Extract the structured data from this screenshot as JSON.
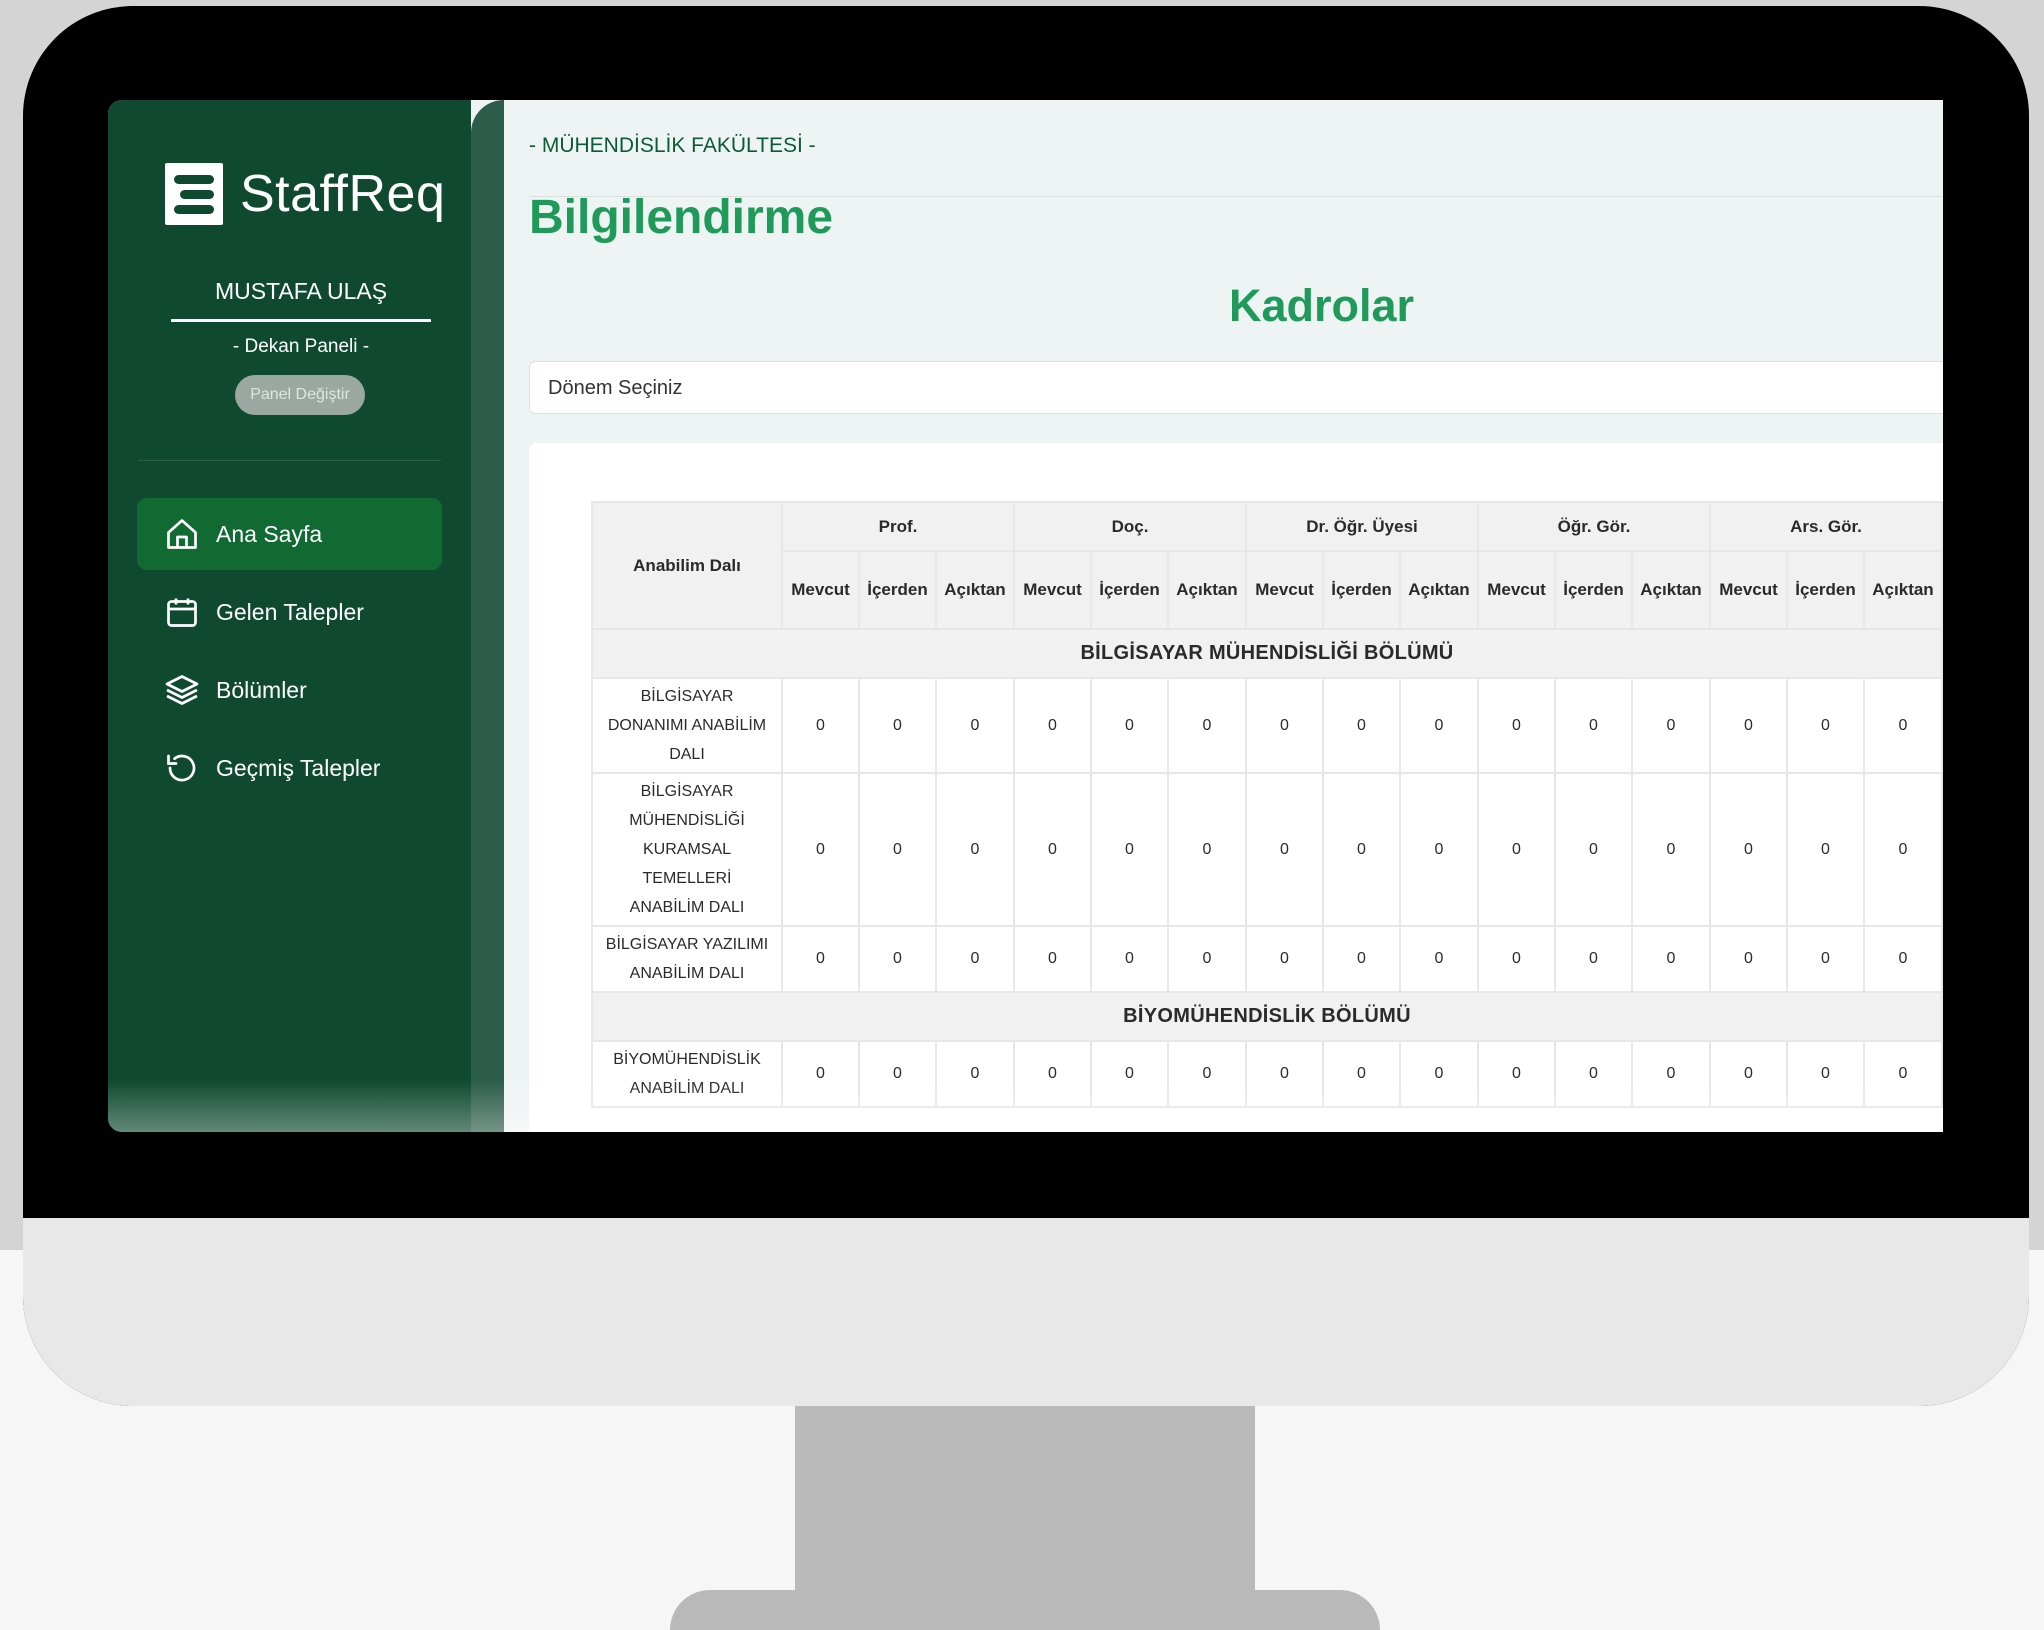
{
  "app": {
    "name": "StaffReq"
  },
  "user": {
    "name": "MUSTAFA ULAŞ",
    "panel": "- Dekan Paneli -",
    "switch_label": "Panel Değiştir"
  },
  "nav": [
    {
      "label": "Ana Sayfa",
      "icon": "home-icon",
      "active": true
    },
    {
      "label": "Gelen Talepler",
      "icon": "calendar-icon",
      "active": false
    },
    {
      "label": "Bölümler",
      "icon": "layers-icon",
      "active": false
    },
    {
      "label": "Geçmiş Talepler",
      "icon": "history-icon",
      "active": false
    }
  ],
  "header": {
    "breadcrumb": "- MÜHENDİSLİK FAKÜLTESİ -",
    "title": "Bilgilendirme"
  },
  "section_title": "Kadrolar",
  "period_select": {
    "placeholder": "Dönem Seçiniz"
  },
  "table": {
    "first_col": "Anabilim Dalı",
    "groups": [
      "Prof.",
      "Doç.",
      "Dr. Öğr. Üyesi",
      "Öğr. Gör.",
      "Ars. Gör."
    ],
    "subcols": [
      "Mevcut",
      "İçerden",
      "Açıktan"
    ],
    "sections": [
      {
        "title": "BİLGİSAYAR MÜHENDİSLİĞİ BÖLÜMÜ",
        "rows": [
          {
            "name": [
              "BİLGİSAYAR",
              "DONANIMI ANABİLİM",
              "DALI"
            ],
            "values": [
              0,
              0,
              0,
              0,
              0,
              0,
              0,
              0,
              0,
              0,
              0,
              0,
              0,
              0,
              0
            ]
          },
          {
            "name": [
              "BİLGİSAYAR",
              "MÜHENDİSLİĞİ",
              "KURAMSAL",
              "TEMELLERİ",
              "ANABİLİM DALI"
            ],
            "values": [
              0,
              0,
              0,
              0,
              0,
              0,
              0,
              0,
              0,
              0,
              0,
              0,
              0,
              0,
              0
            ]
          },
          {
            "name": [
              "BİLGİSAYAR YAZILIMI",
              "ANABİLİM DALI"
            ],
            "values": [
              0,
              0,
              0,
              0,
              0,
              0,
              0,
              0,
              0,
              0,
              0,
              0,
              0,
              0,
              0
            ]
          }
        ]
      },
      {
        "title": "BİYOMÜHENDİSLİK BÖLÜMÜ",
        "rows": [
          {
            "name": [
              "BİYOMÜHENDİSLİK",
              "ANABİLİM DALI"
            ],
            "values": [
              0,
              0,
              0,
              0,
              0,
              0,
              0,
              0,
              0,
              0,
              0,
              0,
              0,
              0,
              0
            ]
          }
        ]
      }
    ]
  },
  "colors": {
    "sidebar": "#0f4a30",
    "active_nav": "#126a33",
    "title": "#1f9a5a"
  }
}
